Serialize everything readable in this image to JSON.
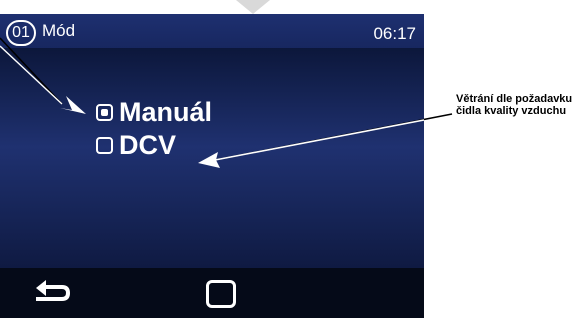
{
  "header": {
    "mode_number": "01",
    "title": "Mód",
    "time": "06:17"
  },
  "options": [
    {
      "label": "Manuál",
      "selected": true
    },
    {
      "label": "DCV",
      "selected": false
    }
  ],
  "bottom_bar": {
    "back_icon": "back-arrow-icon",
    "home_icon": "square-home-icon"
  },
  "annotation": {
    "text": "Větrání dle požadavku čidla kvality vzduchu"
  },
  "colors": {
    "screen_bg": "#0e1a3f",
    "topbar_bg": "#1e3070",
    "text": "#ffffff"
  }
}
